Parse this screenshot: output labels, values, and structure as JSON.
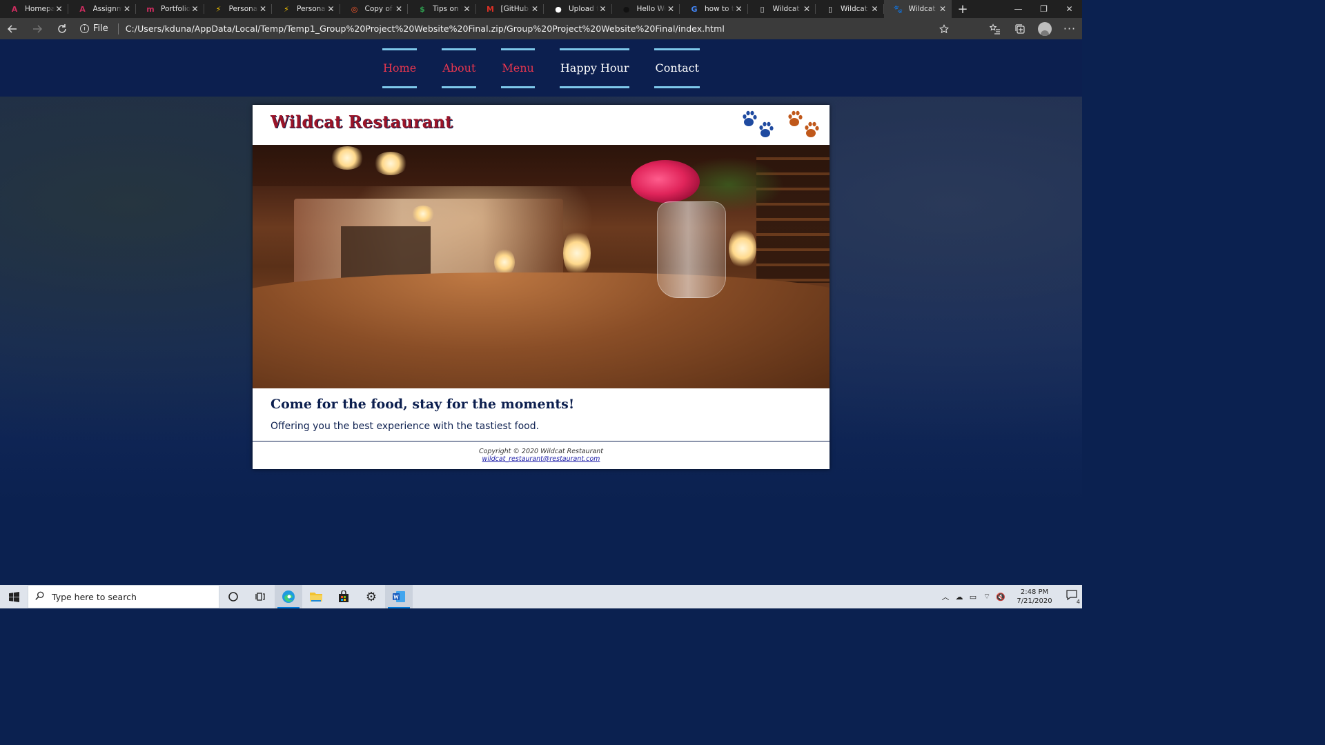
{
  "browser": {
    "tabs": [
      {
        "label": "Homepage",
        "favicon": "A",
        "color": "#cc2d5f"
      },
      {
        "label": "Assignments",
        "favicon": "A",
        "color": "#cc2d5f"
      },
      {
        "label": "Portfolios",
        "favicon": "m",
        "color": "#cc2d5f"
      },
      {
        "label": "Personal F",
        "favicon": "⚡",
        "color": "#f0c000"
      },
      {
        "label": "Personal F",
        "favicon": "⚡",
        "color": "#f0c000"
      },
      {
        "label": "Copy of Si",
        "favicon": "◎",
        "color": "#ff5a2d"
      },
      {
        "label": "Tips on Bu",
        "favicon": "$",
        "color": "#2e9d4f"
      },
      {
        "label": "[GitHub] P",
        "favicon": "M",
        "color": "#d93025"
      },
      {
        "label": "Upload file",
        "favicon": "●",
        "color": "#ffffff"
      },
      {
        "label": "Hello Wor",
        "favicon": "●",
        "color": "#111111"
      },
      {
        "label": "how to tal",
        "favicon": "G",
        "color": "#4285f4"
      },
      {
        "label": "Wildcat Re",
        "favicon": "▯",
        "color": "#dddddd"
      },
      {
        "label": "Wildcat Re",
        "favicon": "▯",
        "color": "#dddddd"
      },
      {
        "label": "Wildcat Re",
        "favicon": "🐾",
        "color": "#2f5aa8"
      }
    ],
    "active_tab_index": 13,
    "new_tab_symbol": "+",
    "window_controls": {
      "minimize": "—",
      "restore": "❐",
      "close": "✕"
    },
    "file_label": "File",
    "url": "C:/Users/kduna/AppData/Local/Temp/Temp1_Group%20Project%20Website%20Final.zip/Group%20Project%20Website%20Final/index.html"
  },
  "site": {
    "nav": [
      {
        "label": "Home",
        "color": "#e8364f"
      },
      {
        "label": "About",
        "color": "#e8364f"
      },
      {
        "label": "Menu",
        "color": "#e8364f"
      },
      {
        "label": "Happy Hour",
        "color": "#ffffff"
      },
      {
        "label": "Contact",
        "color": "#ffffff"
      }
    ],
    "title": "Wildcat Restaurant",
    "tagline": "Come for the food, stay for the moments!",
    "subtext": "Offering you the best experience with the tastiest food.",
    "footer_copyright": "Copyright © 2020 Wildcat Restaurant",
    "footer_email": "wildcat_restaurant@restaurant.com",
    "colors": {
      "navy": "#0c1f4f",
      "crimson": "#9b1428",
      "nav_border": "#7ec8ea",
      "paw_blue": "#1f4aa0",
      "paw_orange": "#c0581a"
    }
  },
  "taskbar": {
    "search_placeholder": "Type here to search",
    "apps": [
      "cortana-icon",
      "task-view-icon",
      "edge-icon",
      "file-explorer-icon",
      "store-icon",
      "settings-icon",
      "word-icon"
    ],
    "time": "2:48 PM",
    "date": "7/21/2020",
    "notification_count": "4"
  }
}
